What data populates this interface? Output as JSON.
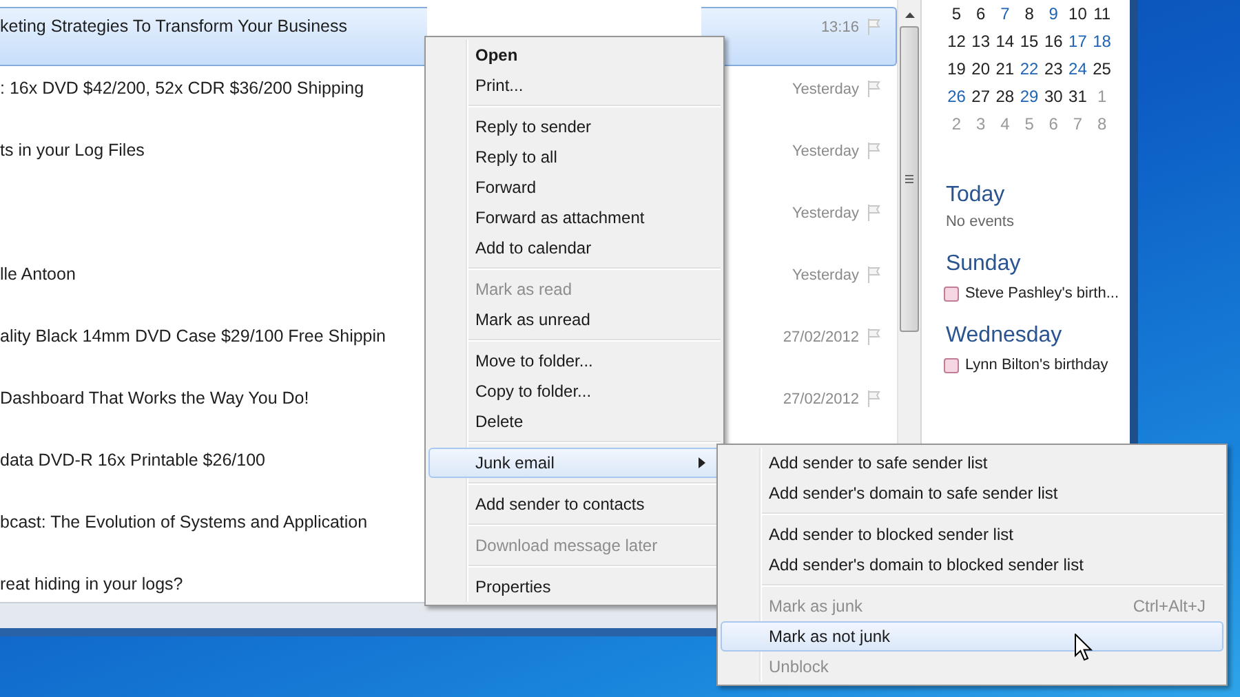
{
  "message_list": {
    "rows": [
      {
        "subject": "keting Strategies To Transform Your Business",
        "date": "13:16",
        "selected": true
      },
      {
        "subject": ": 16x DVD $42/200, 52x CDR $36/200 Shipping",
        "date": "Yesterday",
        "selected": false
      },
      {
        "subject": "ts in your Log Files",
        "date": "Yesterday",
        "selected": false
      },
      {
        "date": "Yesterday",
        "selected": false
      },
      {
        "subject": "lle Antoon",
        "date": "Yesterday",
        "selected": false
      },
      {
        "subject": "ality Black 14mm DVD Case $29/100 Free Shippin",
        "date": "27/02/2012",
        "selected": false
      },
      {
        "subject": "Dashboard That Works the Way You Do!",
        "date": "27/02/2012",
        "selected": false
      },
      {
        "subject": "data DVD-R 16x Printable $26/100",
        "selected": false
      },
      {
        "subject": "bcast:  The Evolution of Systems and Application",
        "selected": false
      },
      {
        "subject": "reat hiding in your logs?",
        "selected": false
      }
    ]
  },
  "calendar": {
    "weeks": [
      [
        {
          "day": "5",
          "kind": "current"
        },
        {
          "day": "6",
          "kind": "current"
        },
        {
          "day": "7",
          "kind": "highlight"
        },
        {
          "day": "8",
          "kind": "current"
        },
        {
          "day": "9",
          "kind": "highlight"
        },
        {
          "day": "10",
          "kind": "current"
        },
        {
          "day": "11",
          "kind": "current"
        }
      ],
      [
        {
          "day": "12",
          "kind": "current"
        },
        {
          "day": "13",
          "kind": "current"
        },
        {
          "day": "14",
          "kind": "current"
        },
        {
          "day": "15",
          "kind": "current"
        },
        {
          "day": "16",
          "kind": "current"
        },
        {
          "day": "17",
          "kind": "highlight"
        },
        {
          "day": "18",
          "kind": "highlight"
        }
      ],
      [
        {
          "day": "19",
          "kind": "current"
        },
        {
          "day": "20",
          "kind": "current"
        },
        {
          "day": "21",
          "kind": "current"
        },
        {
          "day": "22",
          "kind": "highlight"
        },
        {
          "day": "23",
          "kind": "current"
        },
        {
          "day": "24",
          "kind": "highlight"
        },
        {
          "day": "25",
          "kind": "current"
        }
      ],
      [
        {
          "day": "26",
          "kind": "highlight"
        },
        {
          "day": "27",
          "kind": "current"
        },
        {
          "day": "28",
          "kind": "current"
        },
        {
          "day": "29",
          "kind": "highlight"
        },
        {
          "day": "30",
          "kind": "current"
        },
        {
          "day": "31",
          "kind": "current"
        },
        {
          "day": "1",
          "kind": "other"
        }
      ],
      [
        {
          "day": "2",
          "kind": "other"
        },
        {
          "day": "3",
          "kind": "other"
        },
        {
          "day": "4",
          "kind": "other"
        },
        {
          "day": "5",
          "kind": "other"
        },
        {
          "day": "6",
          "kind": "other"
        },
        {
          "day": "7",
          "kind": "other"
        },
        {
          "day": "8",
          "kind": "other"
        }
      ]
    ]
  },
  "agenda": [
    {
      "heading": "Today",
      "note": "No events"
    },
    {
      "heading": "Sunday",
      "events": [
        {
          "title": "Steve Pashley's birth...",
          "checked": false
        }
      ]
    },
    {
      "heading": "Wednesday",
      "events": [
        {
          "title": "Lynn Bilton's birthday",
          "checked": false
        }
      ]
    }
  ],
  "context_menu": {
    "items": [
      {
        "kind": "default",
        "label": "Open",
        "disabled": false,
        "selected": false
      },
      {
        "kind": "item",
        "label": "Print...",
        "disabled": false,
        "selected": false
      },
      {
        "kind": "separator"
      },
      {
        "kind": "item",
        "label": "Reply to sender",
        "disabled": false,
        "selected": false
      },
      {
        "kind": "item",
        "label": "Reply to all",
        "disabled": false,
        "selected": false
      },
      {
        "kind": "item",
        "label": "Forward",
        "disabled": false,
        "selected": false
      },
      {
        "kind": "item",
        "label": "Forward as attachment",
        "disabled": false,
        "selected": false
      },
      {
        "kind": "item",
        "label": "Add to calendar",
        "disabled": false,
        "selected": false
      },
      {
        "kind": "separator"
      },
      {
        "kind": "item",
        "label": "Mark as read",
        "disabled": true,
        "selected": false
      },
      {
        "kind": "item",
        "label": "Mark as unread",
        "disabled": false,
        "selected": false
      },
      {
        "kind": "separator"
      },
      {
        "kind": "item",
        "label": "Move to folder...",
        "disabled": false,
        "selected": false
      },
      {
        "kind": "item",
        "label": "Copy to folder...",
        "disabled": false,
        "selected": false
      },
      {
        "kind": "item",
        "label": "Delete",
        "disabled": false,
        "selected": false
      },
      {
        "kind": "separator"
      },
      {
        "kind": "submenu",
        "label": "Junk email",
        "disabled": false,
        "selected": true
      },
      {
        "kind": "separator"
      },
      {
        "kind": "item",
        "label": "Add sender to contacts",
        "disabled": false,
        "selected": false
      },
      {
        "kind": "separator"
      },
      {
        "kind": "item",
        "label": "Download message later",
        "disabled": true,
        "selected": false
      },
      {
        "kind": "separator"
      },
      {
        "kind": "item",
        "label": "Properties",
        "disabled": false,
        "selected": false
      }
    ]
  },
  "junk_submenu": {
    "items": [
      {
        "kind": "item",
        "label": "Add sender to safe sender list",
        "disabled": false,
        "selected": false
      },
      {
        "kind": "item",
        "label": "Add sender's domain to safe sender list",
        "disabled": false,
        "selected": false
      },
      {
        "kind": "separator"
      },
      {
        "kind": "item",
        "label": "Add sender to blocked sender list",
        "disabled": false,
        "selected": false
      },
      {
        "kind": "item",
        "label": "Add sender's domain to blocked sender list",
        "disabled": false,
        "selected": false
      },
      {
        "kind": "separator"
      },
      {
        "kind": "item",
        "label": "Mark as junk",
        "shortcut": "Ctrl+Alt+J",
        "disabled": true,
        "selected": false
      },
      {
        "kind": "item",
        "label": "Mark as not junk",
        "disabled": false,
        "selected": true
      },
      {
        "kind": "item",
        "label": "Unblock",
        "disabled": true,
        "selected": false
      }
    ]
  }
}
